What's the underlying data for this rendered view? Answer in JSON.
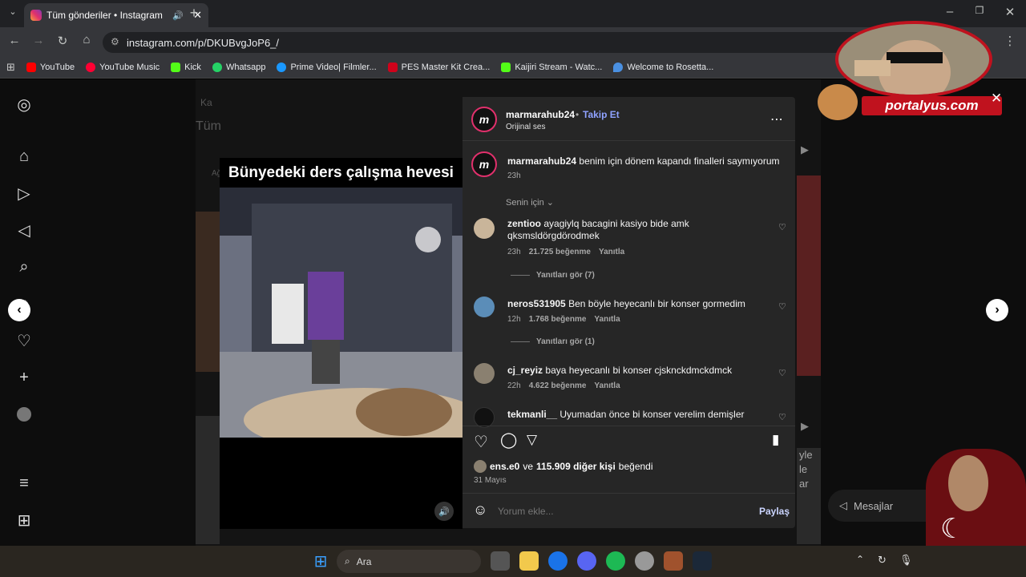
{
  "browser": {
    "tab_title": "Tüm gönderiler • Instagram",
    "url": "instagram.com/p/DKUBvgJoP6_/",
    "bookmarks": [
      {
        "label": "YouTube",
        "color": "#ff0000"
      },
      {
        "label": "YouTube Music",
        "color": "#ff0033"
      },
      {
        "label": "Kick",
        "color": "#53fc18"
      },
      {
        "label": "Whatsapp",
        "color": "#25d366"
      },
      {
        "label": "Prime Video| Filmler...",
        "color": "#1a98ff"
      },
      {
        "label": "PES Master Kit Crea...",
        "color": "#d0021b"
      },
      {
        "label": "Kaijiri Stream - Watc...",
        "color": "#53fc18"
      },
      {
        "label": "Welcome to Rosetta...",
        "color": "#4a90e2"
      }
    ]
  },
  "background": {
    "back_label": "Ka",
    "title_fragment": "Tüm",
    "side_fragment": "Ağ",
    "right_fragment": "yle\nle\nar",
    "messages_label": "Mesajlar"
  },
  "video": {
    "caption": "Bünyedeki ders çalışma hevesi"
  },
  "post": {
    "username": "marmarahub24",
    "follow_label": "Takip Et",
    "audio": "Orijinal ses",
    "avatar_letter": "m",
    "caption_user": "marmarahub24",
    "caption_text": "benim için dönem kapandı finalleri saymıyorum",
    "caption_time": "23h",
    "filter_label": "Senin için",
    "comments": [
      {
        "user": "zentioo",
        "text": "ayagiylq bacagini kasiyo bide amk qksmsldörgdörodmek",
        "time": "23h",
        "likes": "21.725 beğenme",
        "reply": "Yanıtla",
        "view_replies": "Yanıtları gör (7)",
        "avatar_color": "#c9b59a"
      },
      {
        "user": "neros531905",
        "text": "Ben böyle heyecanlı bir konser gormedim",
        "time": "12h",
        "likes": "1.768 beğenme",
        "reply": "Yanıtla",
        "view_replies": "Yanıtları gör (1)",
        "avatar_color": "#5b8db8"
      },
      {
        "user": "cj_reyiz",
        "text": "baya heyecanlı bi konser cjsknckdmckdmck",
        "time": "22h",
        "likes": "4.622 beğenme",
        "reply": "Yanıtla",
        "view_replies": "",
        "avatar_color": "#8a8070"
      },
      {
        "user": "tekmanli__",
        "text": "Uyumadan önce bi konser verelim demişler",
        "time": "",
        "likes": "",
        "reply": "",
        "view_replies": "",
        "avatar_color": "#111111"
      }
    ],
    "liked_by_user": "ens.e0",
    "liked_by_rest": "ve",
    "liked_count": "115.909 diğer kişi",
    "liked_suffix": "beğendi",
    "date": "31 Mayıs",
    "comment_placeholder": "Yorum ekle...",
    "share_label": "Paylaş"
  },
  "overlay": {
    "brand": "portalyus.com"
  },
  "taskbar": {
    "search_label": "Ara"
  }
}
